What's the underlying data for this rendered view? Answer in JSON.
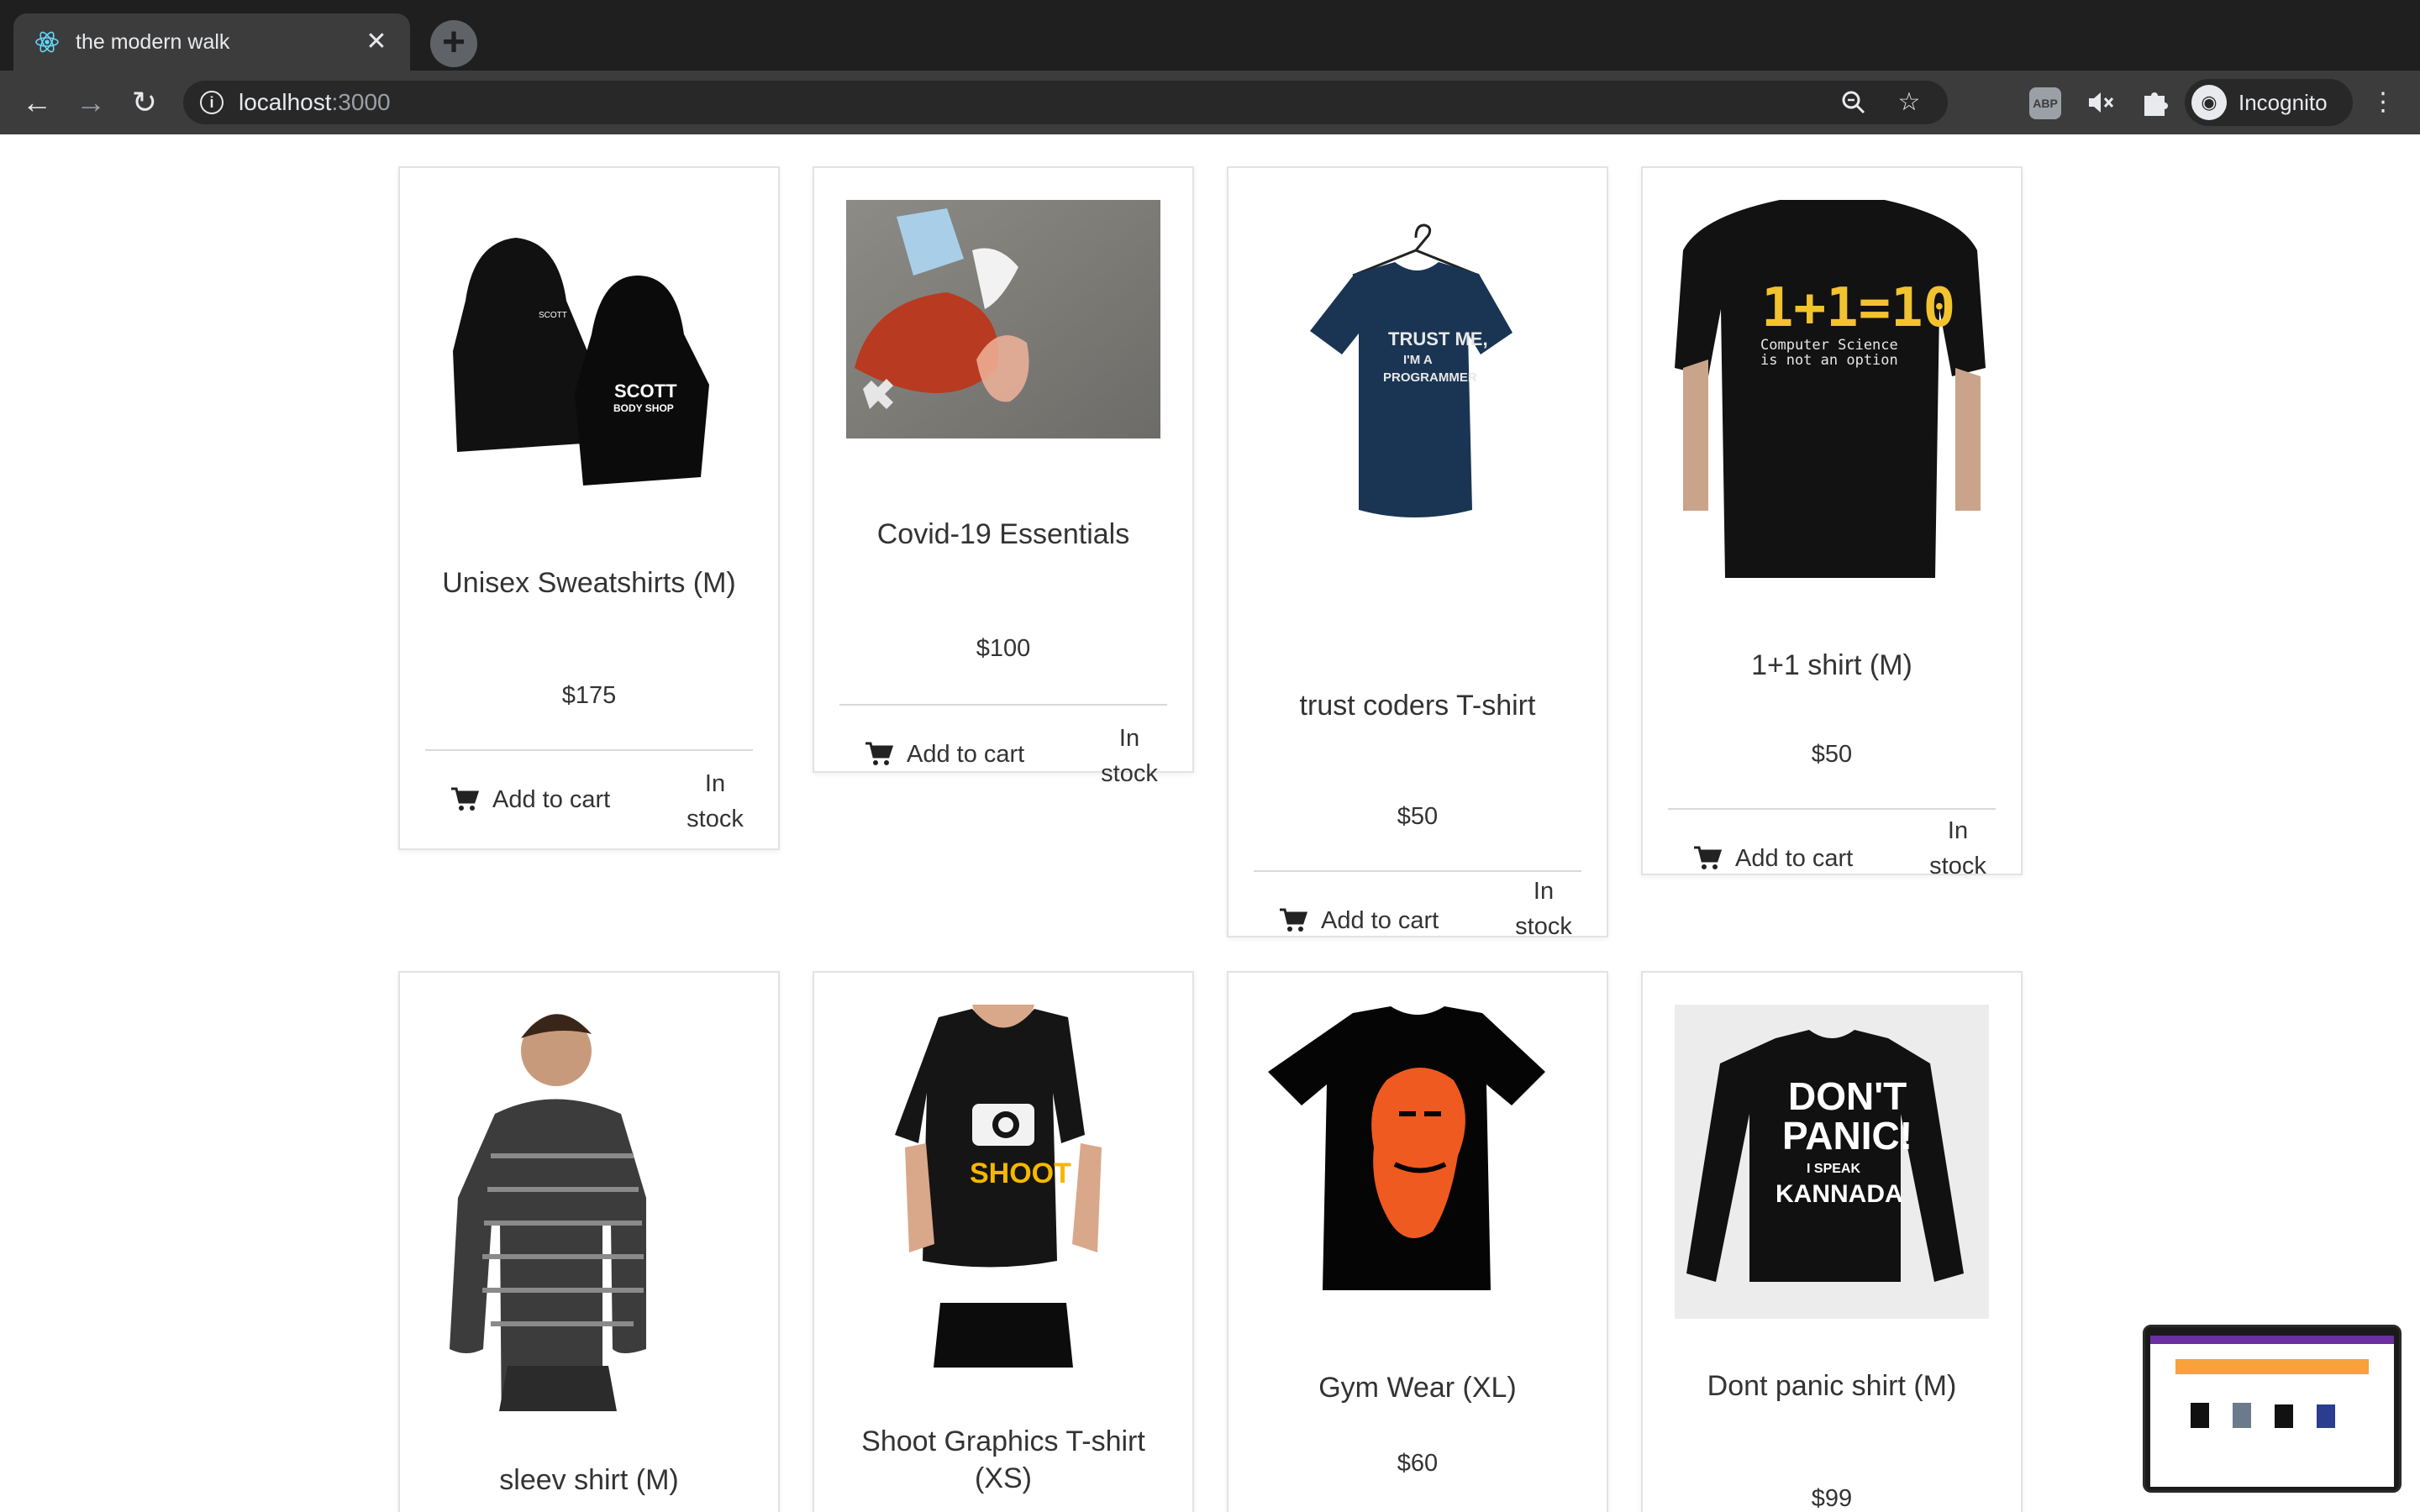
{
  "browser": {
    "tab_title": "the modern walk",
    "tab_close": "✕",
    "new_tab": "+",
    "url_host": "localhost",
    "url_port": ":3000",
    "profile_label": "Incognito",
    "extension_abp": "ABP"
  },
  "products": [
    {
      "title": "Unisex Sweatshirts (M)",
      "price": "$175",
      "cart_label": "Add to cart",
      "stock": "In stock",
      "image": "hoodie"
    },
    {
      "title": "Covid-19 Essentials",
      "price": "$100",
      "cart_label": "Add to cart",
      "stock": "In stock",
      "image": "covid-kit"
    },
    {
      "title": "trust coders T-shirt",
      "price": "$50",
      "cart_label": "Add to cart",
      "stock": "In stock",
      "image": "navy-tshirt"
    },
    {
      "title": "1+1 shirt (M)",
      "price": "$50",
      "cart_label": "Add to cart",
      "stock": "In stock",
      "image": "black-tshirt"
    },
    {
      "title": "sleev shirt (M)",
      "image": "striped-shirt"
    },
    {
      "title": "Shoot Graphics T-shirt (XS)",
      "image": "camera-tshirt"
    },
    {
      "title": "Gym Wear (XL)",
      "price": "$60",
      "image": "hanuman-tshirt"
    },
    {
      "title": "Dont panic shirt (M)",
      "price": "$99",
      "image": "longsleeve"
    }
  ],
  "image_text": {
    "hoodie": [
      "SCOTT",
      "BODY SHOP"
    ],
    "navy": [
      "TRUST ME,",
      "I'M A",
      "PROGRAMMER"
    ],
    "eq": [
      "1+1=10",
      "Computer Science",
      "is not an option"
    ],
    "shoot": "SHOOT",
    "panic": [
      "DON'T",
      "PANIC!",
      "I SPEAK",
      "KANNADA"
    ]
  },
  "colors": {
    "chrome_dark": "#1f1f1f",
    "toolbar": "#3c3c3c",
    "text": "#333333",
    "divider": "#d9d9d9"
  }
}
